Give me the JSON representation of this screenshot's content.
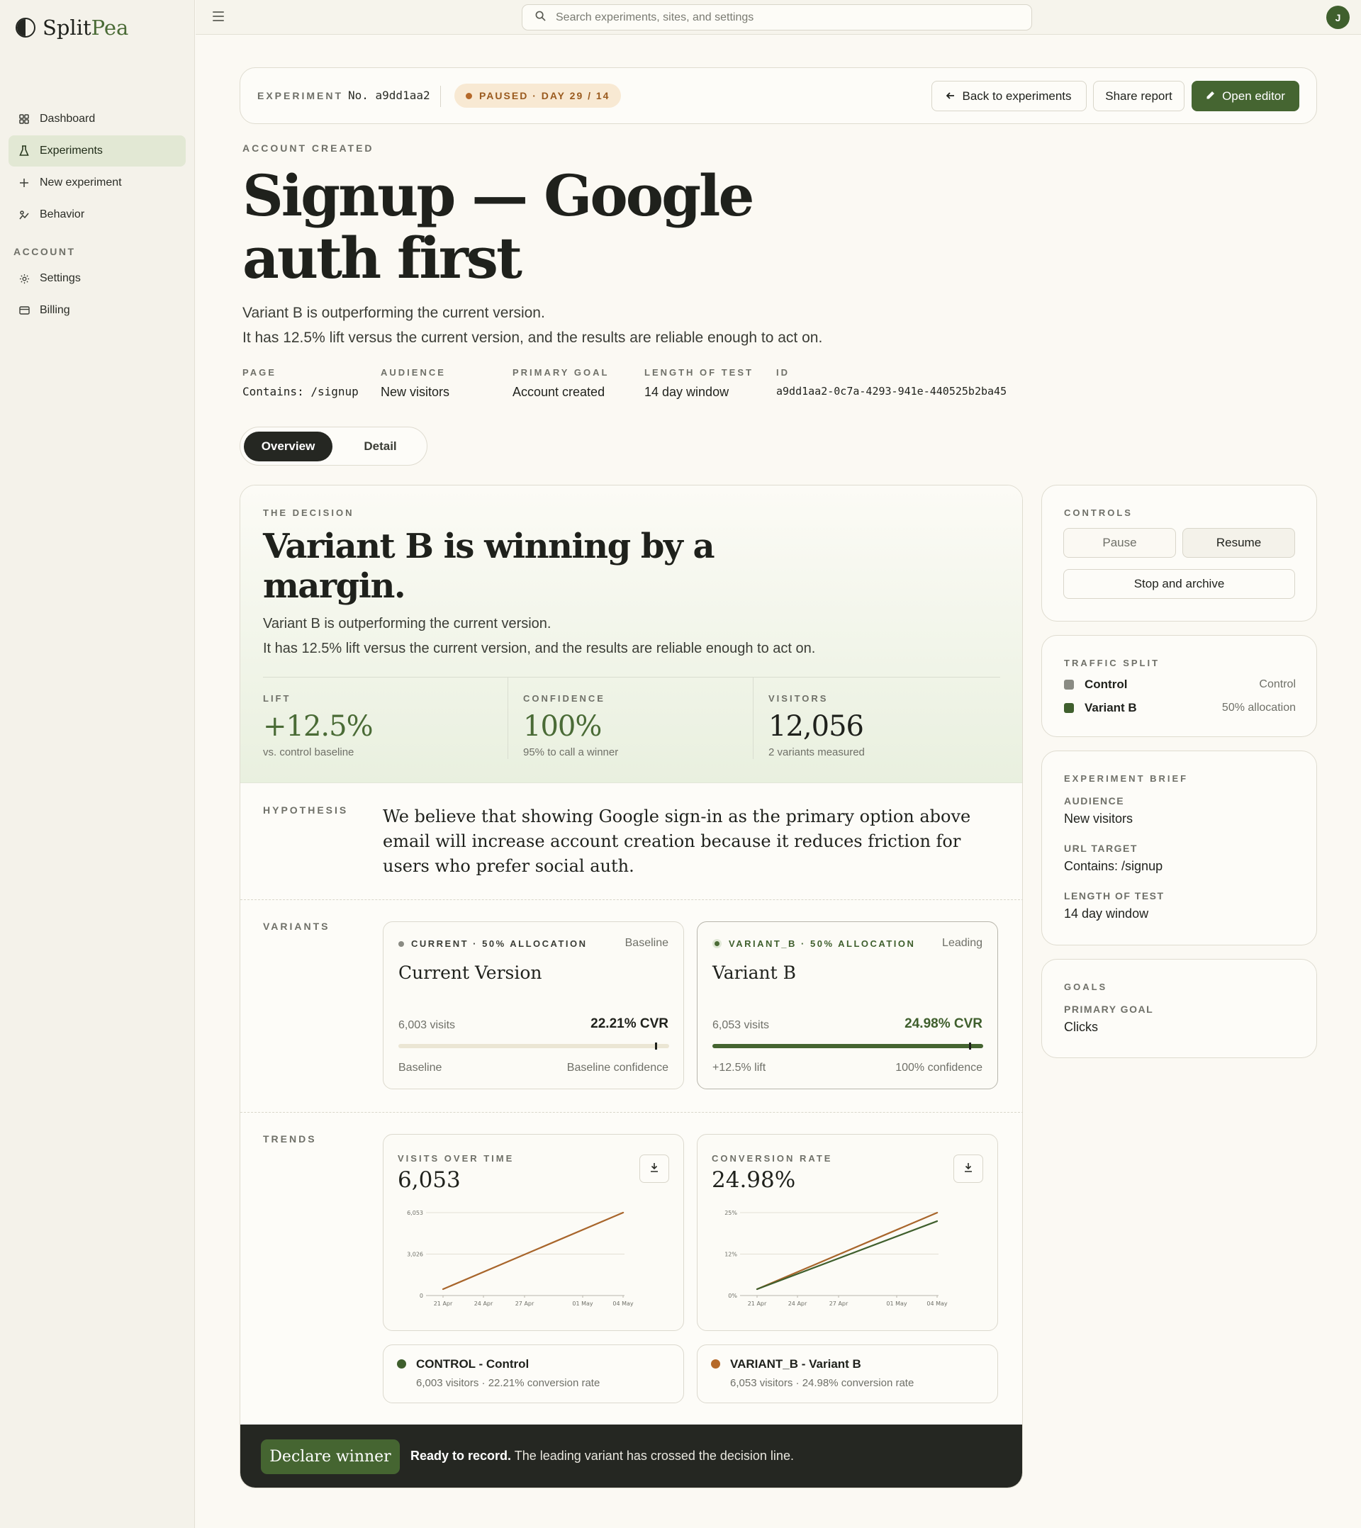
{
  "app": {
    "name_a": "Split",
    "name_b": "Pea"
  },
  "sidebar": {
    "items": [
      {
        "label": "Dashboard",
        "icon": "grid-icon"
      },
      {
        "label": "Experiments",
        "icon": "flask-icon"
      },
      {
        "label": "New experiment",
        "icon": "plus-icon"
      },
      {
        "label": "Behavior",
        "icon": "behavior-icon"
      }
    ],
    "section": "ACCOUNT",
    "account_items": [
      {
        "label": "Settings",
        "icon": "gear-icon"
      },
      {
        "label": "Billing",
        "icon": "card-icon"
      }
    ]
  },
  "topbar": {
    "search_placeholder": "Search experiments, sites, and settings",
    "avatar": "J"
  },
  "header": {
    "experiment_label": "EXPERIMENT",
    "experiment_no": "No. a9dd1aa2",
    "status": "PAUSED · DAY 29 / 14",
    "back_label": "Back to experiments",
    "share_label": "Share report",
    "editor_label": "Open editor"
  },
  "hero": {
    "eyebrow": "ACCOUNT CREATED",
    "title": "Signup — Google auth first",
    "sub1": "Variant B is outperforming the current version.",
    "sub2": "It has 12.5% lift versus the current version, and the results are reliable enough to act on.",
    "meta": [
      {
        "label": "PAGE",
        "value": "Contains: /signup",
        "mono": true
      },
      {
        "label": "AUDIENCE",
        "value": "New visitors",
        "mono": false
      },
      {
        "label": "PRIMARY GOAL",
        "value": "Account created",
        "mono": false
      },
      {
        "label": "LENGTH OF TEST",
        "value": "14 day window",
        "mono": false
      },
      {
        "label": "ID",
        "value": "a9dd1aa2-0c7a-4293-941e-440525b2ba45",
        "mono": true
      }
    ]
  },
  "tabs": {
    "overview": "Overview",
    "detail": "Detail"
  },
  "decision": {
    "eyebrow": "THE DECISION",
    "title": "Variant B is winning by a margin.",
    "sub1": "Variant B is outperforming the current version.",
    "sub2": "It has 12.5% lift versus the current version, and the results are reliable enough to act on.",
    "stats": [
      {
        "label": "LIFT",
        "value": "+12.5%",
        "note": "vs. control baseline"
      },
      {
        "label": "CONFIDENCE",
        "value": "100%",
        "note": "95% to call a winner"
      },
      {
        "label": "VISITORS",
        "value": "12,056",
        "note": "2 variants measured"
      }
    ]
  },
  "hypothesis": {
    "label": "HYPOTHESIS",
    "text": "We believe that showing Google sign-in as the primary option above email will increase account creation because it reduces friction for users who prefer social auth."
  },
  "variants": {
    "label": "VARIANTS",
    "items": [
      {
        "tag": "CURRENT · 50% ALLOCATION",
        "status": "Baseline",
        "name": "Current Version",
        "visits": "6,003 visits",
        "cvr": "22.21% CVR",
        "foot_l": "Baseline",
        "foot_r": "Baseline confidence",
        "confidence_fill": 0
      },
      {
        "tag": "VARIANT_B · 50% ALLOCATION",
        "status": "Leading",
        "name": "Variant B",
        "visits": "6,053 visits",
        "cvr": "24.98% CVR",
        "foot_l": "+12.5% lift",
        "foot_r": "100% confidence",
        "confidence_fill": 1.0
      }
    ]
  },
  "trends": {
    "label": "TRENDS",
    "visits": {
      "title": "VISITS OVER TIME",
      "value": "6,053"
    },
    "conversion": {
      "title": "CONVERSION RATE",
      "value": "24.98%"
    }
  },
  "chart_data": [
    {
      "type": "line",
      "title": "VISITS OVER TIME",
      "x": [
        "21 Apr",
        "24 Apr",
        "27 Apr",
        "01 May",
        "04 May"
      ],
      "yticks": [
        "0",
        "3,026",
        "6,053"
      ],
      "ylim": [
        0,
        6053
      ],
      "series": [
        {
          "color": "#a8652b",
          "points": [
            [
              0,
              0
            ],
            [
              1,
              6053
            ]
          ]
        }
      ]
    },
    {
      "type": "line",
      "title": "CONVERSION RATE",
      "x": [
        "21 Apr",
        "24 Apr",
        "27 Apr",
        "01 May",
        "04 May"
      ],
      "yticks": [
        "0%",
        "12%",
        "25%"
      ],
      "ylim": [
        0,
        25
      ],
      "series": [
        {
          "color": "#a8652b",
          "points": [
            [
              0,
              0
            ],
            [
              1,
              24.98
            ]
          ]
        },
        {
          "color": "#3f5f2d",
          "points": [
            [
              0,
              0
            ],
            [
              1,
              22.21
            ]
          ]
        }
      ]
    }
  ],
  "legend": [
    {
      "name": "CONTROL - Control",
      "sub": "6,003 visitors · 22.21% conversion rate",
      "color": "#3f5f2d"
    },
    {
      "name": "VARIANT_B - Variant B",
      "sub": "6,053 visitors · 24.98% conversion rate",
      "color": "#b5692a"
    }
  ],
  "footer": {
    "button": "Declare winner",
    "bold": "Ready to record.",
    "text": " The leading variant has crossed the decision line."
  },
  "controls": {
    "label": "CONTROLS",
    "pause": "Pause",
    "resume": "Resume",
    "stop": "Stop and archive"
  },
  "traffic": {
    "label": "TRAFFIC SPLIT",
    "rows": [
      {
        "name": "Control",
        "value": "Control",
        "color": "#8a8b83"
      },
      {
        "name": "Variant B",
        "value": "50% allocation",
        "color": "#3f5f2d"
      }
    ]
  },
  "brief": {
    "label": "EXPERIMENT BRIEF",
    "rows": [
      {
        "label": "AUDIENCE",
        "value": "New visitors"
      },
      {
        "label": "URL TARGET",
        "value": "Contains: /signup"
      },
      {
        "label": "LENGTH OF TEST",
        "value": "14 day window"
      }
    ]
  },
  "goals": {
    "label": "GOALS",
    "primary_label": "PRIMARY GOAL",
    "primary_value": "Clicks"
  }
}
